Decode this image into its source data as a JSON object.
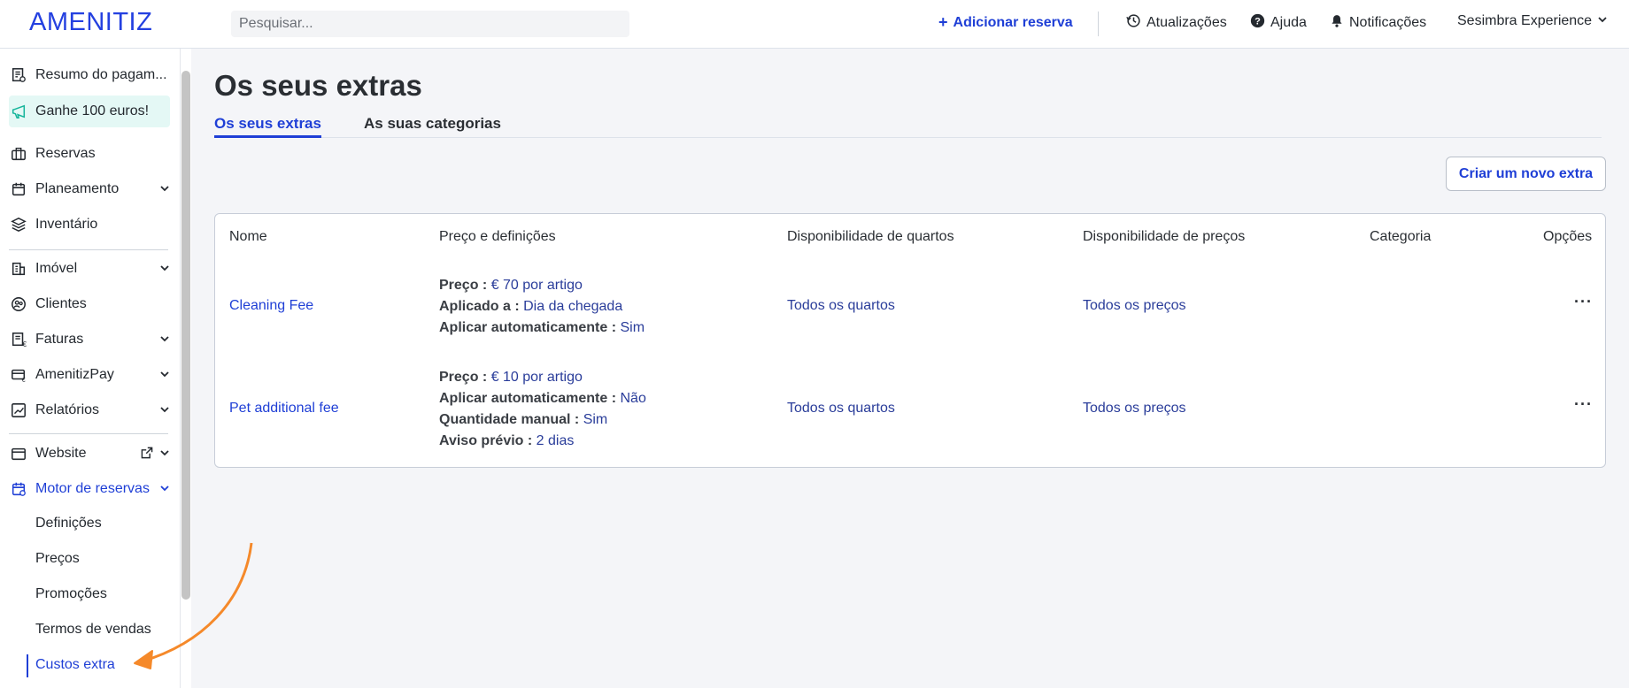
{
  "brand": {
    "logo_text": "AMENITIZ",
    "accent_color": "#1f3fd6"
  },
  "header": {
    "search_placeholder": "Pesquisar...",
    "add_booking": "Adicionar reserva",
    "updates": "Atualizações",
    "help": "Ajuda",
    "notifications": "Notificações",
    "account": "Sesimbra Experience"
  },
  "sidebar": {
    "items": [
      {
        "label": "Resumo do pagam...",
        "icon": "receipt-icon"
      },
      {
        "label": "Ganhe 100 euros!",
        "icon": "megaphone-icon"
      },
      {
        "label": "Reservas",
        "icon": "suitcase-icon"
      },
      {
        "label": "Planeamento",
        "icon": "calendar-icon"
      },
      {
        "label": "Inventário",
        "icon": "layers-icon"
      },
      {
        "label": "Imóvel",
        "icon": "building-icon"
      },
      {
        "label": "Clientes",
        "icon": "users-icon"
      },
      {
        "label": "Faturas",
        "icon": "invoice-icon"
      },
      {
        "label": "AmenitizPay",
        "icon": "card-icon"
      },
      {
        "label": "Relatórios",
        "icon": "chart-icon"
      },
      {
        "label": "Website",
        "icon": "browser-icon"
      },
      {
        "label": "Motor de reservas",
        "icon": "booking-engine-icon"
      }
    ],
    "sub_items": [
      "Definições",
      "Preços",
      "Promoções",
      "Termos de vendas",
      "Custos extra"
    ]
  },
  "main": {
    "title": "Os seus extras",
    "tabs": [
      "Os seus extras",
      "As suas categorias"
    ],
    "new_button": "Criar um novo extra",
    "columns": [
      "Nome",
      "Preço e definições",
      "Disponibilidade de quartos",
      "Disponibilidade de preços",
      "Categoria",
      "Opções"
    ],
    "rows": [
      {
        "name": "Cleaning Fee",
        "specs": [
          {
            "k": "Preço : ",
            "v": "€ 70 por artigo"
          },
          {
            "k": "Aplicado a : ",
            "v": "Dia da chegada"
          },
          {
            "k": "Aplicar automaticamente : ",
            "v": "Sim"
          }
        ],
        "rooms": "Todos os quartos",
        "prices": "Todos os preços",
        "options": "···"
      },
      {
        "name": "Pet additional fee",
        "specs": [
          {
            "k": "Preço : ",
            "v": "€ 10 por artigo"
          },
          {
            "k": "Aplicar automaticamente : ",
            "v": "Não"
          },
          {
            "k": "Quantidade manual : ",
            "v": "Sim"
          },
          {
            "k": "Aviso prévio : ",
            "v": "2 dias"
          }
        ],
        "rooms": "Todos os quartos",
        "prices": "Todos os preços",
        "options": "···"
      }
    ]
  }
}
